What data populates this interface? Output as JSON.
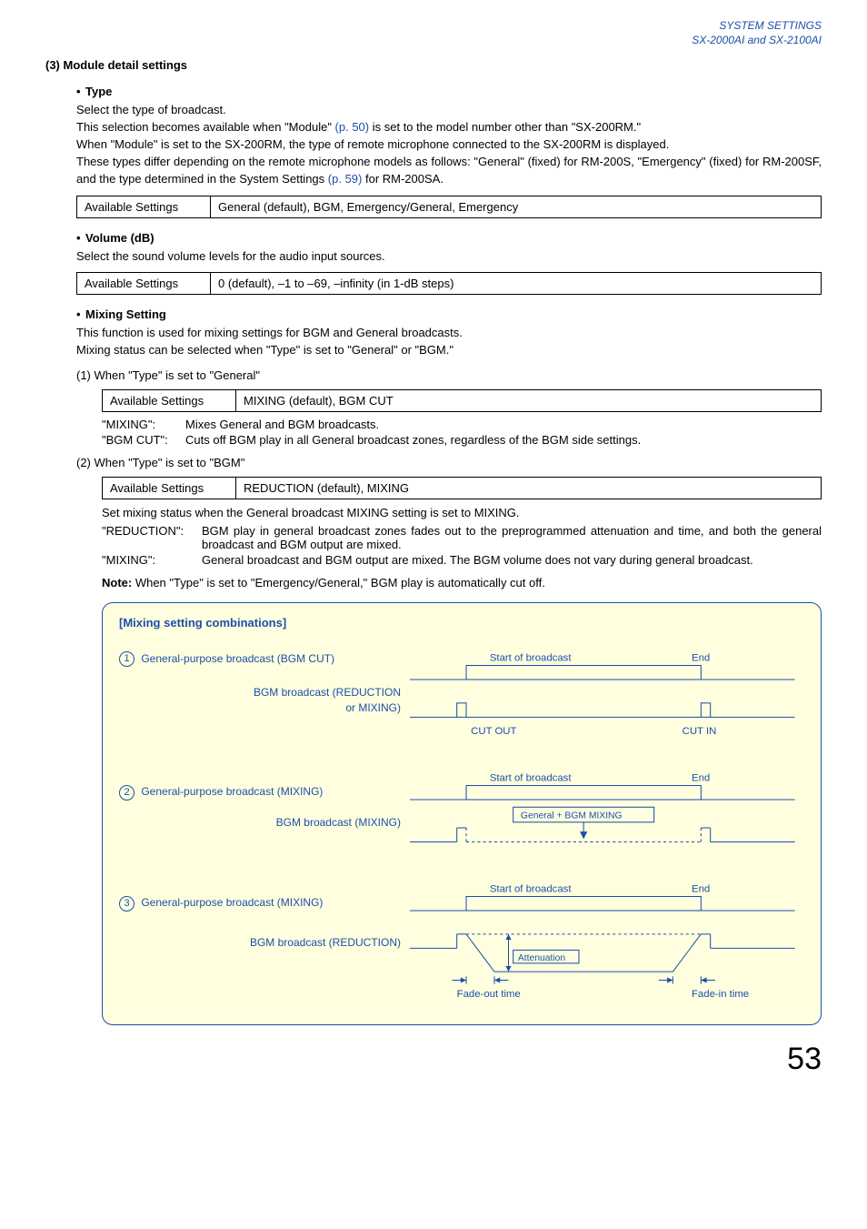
{
  "header": {
    "line1": "SYSTEM SETTINGS",
    "line2": "SX-2000AI and SX-2100AI"
  },
  "section_title": "(3) Module detail settings",
  "type": {
    "heading": "Type",
    "p1": "Select the type of broadcast.",
    "p2a": "This selection becomes available when \"Module\" ",
    "p2_link": "(p. 50)",
    "p2b": " is set to the model number other than \"SX-200RM.\"",
    "p3": "When \"Module\" is set to the SX-200RM, the type of remote microphone connected to the SX-200RM is displayed.",
    "p4a": "These types differ depending on the remote microphone models as follows: \"General\" (fixed) for RM-200S, \"Emergency\" (fixed) for RM-200SF, and the type determined in the System Settings ",
    "p4_link": "(p. 59)",
    "p4b": " for RM-200SA.",
    "table_label": "Available Settings",
    "table_value": "General (default), BGM, Emergency/General, Emergency"
  },
  "volume": {
    "heading": "Volume (dB)",
    "p1": "Select the sound volume levels for the audio input sources.",
    "table_label": "Available Settings",
    "table_value": "0 (default), –1 to –69, –infinity (in 1-dB steps)"
  },
  "mixing": {
    "heading": "Mixing Setting",
    "p1": "This function is used for mixing settings for BGM and General broadcasts.",
    "p2": "Mixing status can be selected when \"Type\" is set to \"General\" or \"BGM.\"",
    "case1_title": "(1)  When \"Type\" is set to \"General\"",
    "case1_table_label": "Available Settings",
    "case1_table_value": "MIXING (default), BGM CUT",
    "case1_def1_term": "\"MIXING\":",
    "case1_def1_body": "Mixes General and BGM broadcasts.",
    "case1_def2_term": "\"BGM CUT\":",
    "case1_def2_body": "Cuts off BGM play in all General broadcast zones, regardless of the BGM side settings.",
    "case2_title": "(2)  When \"Type\" is set to \"BGM\"",
    "case2_table_label": "Available Settings",
    "case2_table_value": "REDUCTION (default), MIXING",
    "case2_intro": "Set mixing status when the General broadcast MIXING setting is set to MIXING.",
    "case2_def1_term": "\"REDUCTION\":",
    "case2_def1_body": "BGM play in general broadcast zones fades out to the preprogrammed attenuation and time, and both the general broadcast and BGM output are mixed.",
    "case2_def2_term": "\"MIXING\":",
    "case2_def2_body": "General broadcast and BGM output are mixed. The BGM volume does not vary during general broadcast.",
    "note_label": "Note:",
    "note_body": " When \"Type\" is set to \"Emergency/General,\" BGM play is automatically cut off."
  },
  "diagram": {
    "title": "[Mixing setting combinations]",
    "start_label": "Start of broadcast",
    "end_label": "End",
    "row1_left_a": "General-purpose broadcast (BGM CUT)",
    "row1_left_b1": "BGM broadcast (REDUCTION",
    "row1_left_b2": "or MIXING)",
    "cut_out": "CUT OUT",
    "cut_in": "CUT IN",
    "row2_left_a": "General-purpose broadcast (MIXING)",
    "row2_left_b": "BGM broadcast (MIXING)",
    "mixing_box": "General  +  BGM MIXING",
    "row3_left_a": "General-purpose broadcast (MIXING)",
    "row3_left_b": "BGM broadcast (REDUCTION)",
    "attenuation": "Attenuation",
    "fade_out": "Fade-out time",
    "fade_in": "Fade-in time"
  },
  "page_number": "53"
}
